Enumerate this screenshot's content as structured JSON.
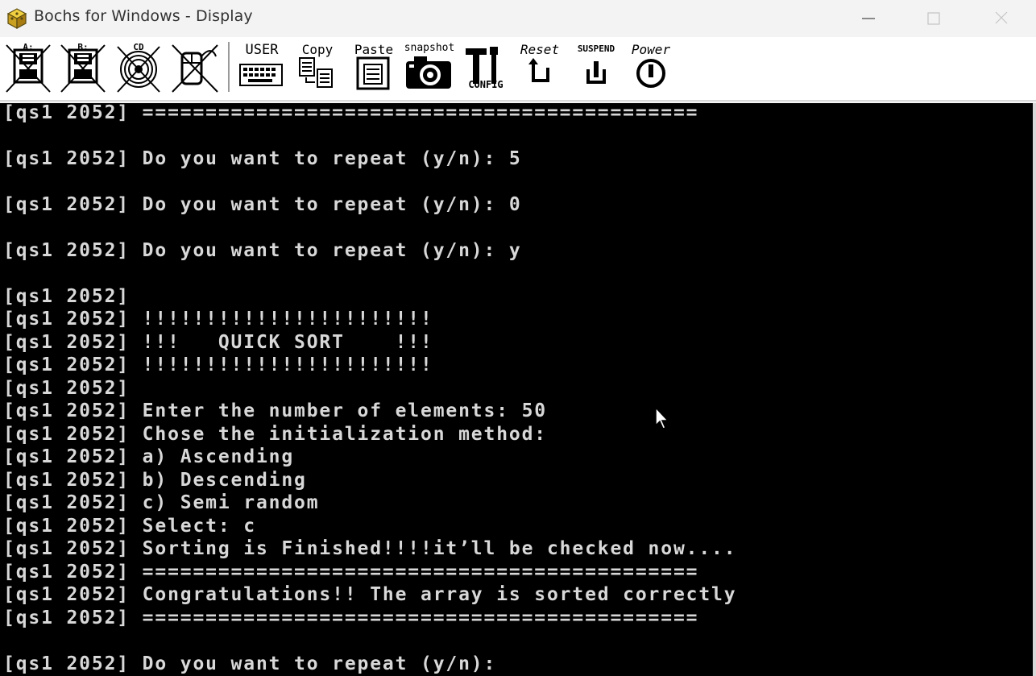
{
  "window": {
    "title": "Bochs for Windows - Display"
  },
  "toolbar": {
    "buttons": [
      {
        "label": "A:",
        "icon": "floppy-a-icon"
      },
      {
        "label": "B:",
        "icon": "floppy-b-icon"
      },
      {
        "label": "CD",
        "icon": "cdrom-icon"
      },
      {
        "label": "",
        "icon": "mouse-icon"
      },
      {
        "label": "USER",
        "icon": "keyboard-icon"
      },
      {
        "label": "Copy",
        "icon": "copy-icon"
      },
      {
        "label": "Paste",
        "icon": "paste-icon"
      },
      {
        "label": "snapshot",
        "icon": "camera-icon"
      },
      {
        "label": "CONFIG",
        "icon": "config-icon"
      },
      {
        "label": "Reset",
        "icon": "reset-icon"
      },
      {
        "label": "SUSPEND",
        "icon": "suspend-icon"
      },
      {
        "label": "Power",
        "icon": "power-icon"
      }
    ]
  },
  "console": {
    "lines": [
      "[qs1 2052] ============================================",
      "",
      "[qs1 2052] Do you want to repeat (y/n): 5",
      "",
      "[qs1 2052] Do you want to repeat (y/n): 0",
      "",
      "[qs1 2052] Do you want to repeat (y/n): y",
      "",
      "[qs1 2052]",
      "[qs1 2052] !!!!!!!!!!!!!!!!!!!!!!!",
      "[qs1 2052] !!!   QUICK SORT    !!!",
      "[qs1 2052] !!!!!!!!!!!!!!!!!!!!!!!",
      "[qs1 2052]",
      "[qs1 2052] Enter the number of elements: 50",
      "[qs1 2052] Chose the initialization method:",
      "[qs1 2052] a) Ascending",
      "[qs1 2052] b) Descending",
      "[qs1 2052] c) Semi random",
      "[qs1 2052] Select: c",
      "[qs1 2052] Sorting is Finished!!!!it’ll be checked now....",
      "[qs1 2052] ============================================",
      "[qs1 2052] Congratulations!! The array is sorted correctly",
      "[qs1 2052] ============================================",
      "",
      "[qs1 2052] Do you want to repeat (y/n):"
    ]
  },
  "colors": {
    "console_bg": "#000000",
    "console_fg": "#d8d8d8",
    "titlebar_bg": "#f3f3f3"
  }
}
